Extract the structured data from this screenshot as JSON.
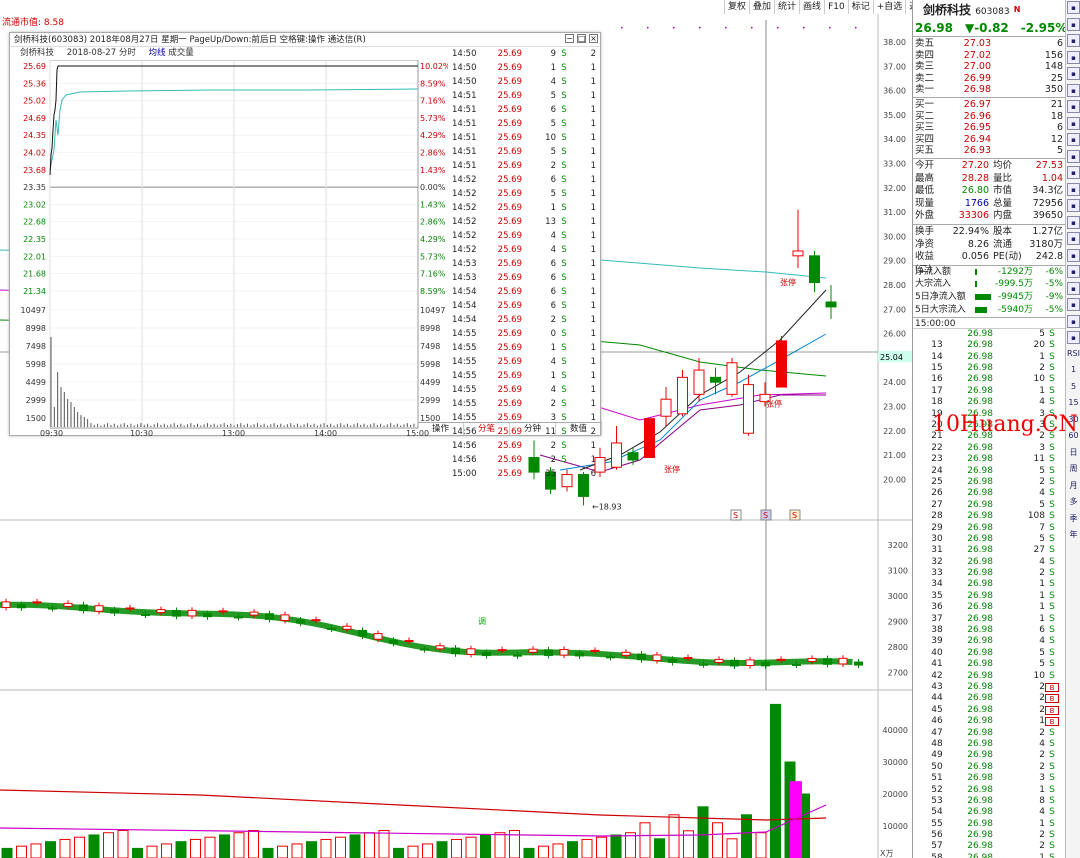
{
  "toolbar": [
    "复权",
    "叠加",
    "统计",
    "画线",
    "F10",
    "标记",
    "+自选",
    "返回"
  ],
  "market_cap": "流通市值: 8.58",
  "main_chart": {
    "price_axis": [
      "38.00",
      "37.00",
      "36.00",
      "35.00",
      "34.00",
      "33.00",
      "32.00",
      "31.00",
      "30.00",
      "29.00",
      "28.00",
      "27.00",
      "26.00",
      "25.00",
      "24.00",
      "23.00",
      "22.00",
      "21.00",
      "20.00"
    ],
    "current_price_label": "25.04",
    "low_label": "18.93",
    "limit_labels": [
      "张停",
      "张停",
      "张停"
    ],
    "index_axis": [
      "3200",
      "3100",
      "3000",
      "2900",
      "2800",
      "2700"
    ],
    "volume_axis": [
      "40000",
      "30000",
      "20000",
      "10000"
    ],
    "volume_unit": "X万",
    "index_badge": "调",
    "marker_icons": [
      "S",
      "S",
      "S"
    ],
    "candles": [
      {
        "o": 20.9,
        "c": 20.3,
        "h": 21.6,
        "l": 20.0
      },
      {
        "o": 20.3,
        "c": 19.6,
        "h": 20.5,
        "l": 19.4
      },
      {
        "o": 19.7,
        "c": 20.2,
        "h": 20.4,
        "l": 19.5
      },
      {
        "o": 20.2,
        "c": 19.3,
        "h": 20.3,
        "l": 18.93
      },
      {
        "o": 20.3,
        "c": 20.9,
        "h": 21.3,
        "l": 20.1
      },
      {
        "o": 20.5,
        "c": 21.5,
        "h": 22.2,
        "l": 20.4
      },
      {
        "o": 21.1,
        "c": 20.8,
        "h": 21.3,
        "l": 20.6
      },
      {
        "o": 20.9,
        "c": 22.5,
        "h": 22.5,
        "l": 20.9
      },
      {
        "o": 22.6,
        "c": 23.3,
        "h": 23.8,
        "l": 22.2
      },
      {
        "o": 22.7,
        "c": 24.2,
        "h": 24.5,
        "l": 22.6
      },
      {
        "o": 23.5,
        "c": 24.5,
        "h": 25.0,
        "l": 23.2
      },
      {
        "o": 24.2,
        "c": 24.0,
        "h": 24.6,
        "l": 23.5
      },
      {
        "o": 23.5,
        "c": 24.8,
        "h": 25.0,
        "l": 23.4
      },
      {
        "o": 21.9,
        "c": 23.9,
        "h": 24.3,
        "l": 21.8
      },
      {
        "o": 23.2,
        "c": 23.5,
        "h": 24.0,
        "l": 23.0
      },
      {
        "o": 23.8,
        "c": 25.7,
        "h": 25.9,
        "l": 23.8
      },
      {
        "o": 29.2,
        "c": 29.4,
        "h": 31.1,
        "l": 28.7
      },
      {
        "o": 29.2,
        "c": 28.1,
        "h": 29.4,
        "l": 27.7
      },
      {
        "o": 27.3,
        "c": 27.1,
        "h": 28.0,
        "l": 26.6
      }
    ]
  },
  "popup": {
    "title": "剑桥科技(603083)  2018年08月27日 星期一  PageUp/Down:前后日 空格键:操作 通达信(R)",
    "header": {
      "name": "剑桥科技",
      "date": "2018-08-27 分时",
      "avg": "均线",
      "vol": "成交量"
    },
    "left_axis": [
      "25.69",
      "25.36",
      "25.02",
      "24.69",
      "24.35",
      "24.02",
      "23.68",
      "23.35",
      "23.02",
      "22.68",
      "22.35",
      "22.01",
      "21.68",
      "21.34",
      "10497",
      "8998",
      "7498",
      "5998",
      "4499",
      "2999",
      "1500"
    ],
    "right_axis": [
      "10.02%",
      "8.59%",
      "7.16%",
      "5.73%",
      "4.29%",
      "2.86%",
      "1.43%",
      "0.00%",
      "1.43%",
      "2.86%",
      "4.29%",
      "5.73%",
      "7.16%",
      "8.59%",
      "10497",
      "8998",
      "7498",
      "5998",
      "4499",
      "2999",
      "1500"
    ],
    "time_axis": [
      "09:30",
      "10:30",
      "13:00",
      "14:00",
      "15:00"
    ],
    "trades": [
      [
        "14:50",
        "25.69",
        "9",
        "S",
        "2"
      ],
      [
        "14:50",
        "25.69",
        "1",
        "S",
        "1"
      ],
      [
        "14:50",
        "25.69",
        "4",
        "S",
        "1"
      ],
      [
        "14:51",
        "25.69",
        "5",
        "S",
        "1"
      ],
      [
        "14:51",
        "25.69",
        "6",
        "S",
        "1"
      ],
      [
        "14:51",
        "25.69",
        "5",
        "S",
        "1"
      ],
      [
        "14:51",
        "25.69",
        "10",
        "S",
        "1"
      ],
      [
        "14:51",
        "25.69",
        "5",
        "S",
        "1"
      ],
      [
        "14:51",
        "25.69",
        "2",
        "S",
        "1"
      ],
      [
        "14:52",
        "25.69",
        "6",
        "S",
        "1"
      ],
      [
        "14:52",
        "25.69",
        "5",
        "S",
        "1"
      ],
      [
        "14:52",
        "25.69",
        "1",
        "S",
        "1"
      ],
      [
        "14:52",
        "25.69",
        "13",
        "S",
        "1"
      ],
      [
        "14:52",
        "25.69",
        "4",
        "S",
        "1"
      ],
      [
        "14:52",
        "25.69",
        "4",
        "S",
        "1"
      ],
      [
        "14:53",
        "25.69",
        "6",
        "S",
        "1"
      ],
      [
        "14:53",
        "25.69",
        "6",
        "S",
        "1"
      ],
      [
        "14:54",
        "25.69",
        "6",
        "S",
        "1"
      ],
      [
        "14:54",
        "25.69",
        "6",
        "S",
        "1"
      ],
      [
        "14:54",
        "25.69",
        "2",
        "S",
        "1"
      ],
      [
        "14:55",
        "25.69",
        "0",
        "S",
        "1"
      ],
      [
        "14:55",
        "25.69",
        "1",
        "S",
        "1"
      ],
      [
        "14:55",
        "25.69",
        "4",
        "S",
        "1"
      ],
      [
        "14:55",
        "25.69",
        "1",
        "S",
        "1"
      ],
      [
        "14:55",
        "25.69",
        "4",
        "S",
        "1"
      ],
      [
        "14:55",
        "25.69",
        "2",
        "S",
        "1"
      ],
      [
        "14:55",
        "25.69",
        "3",
        "S",
        "1"
      ],
      [
        "14:56",
        "25.69",
        "11",
        "S",
        "2"
      ],
      [
        "14:56",
        "25.69",
        "2",
        "S",
        "1"
      ],
      [
        "14:56",
        "25.69",
        "2",
        "S",
        "1"
      ],
      [
        "15:00",
        "25.69",
        "35",
        "",
        "6"
      ]
    ],
    "tabs": [
      "操作",
      "分笔",
      "分钟",
      "数值"
    ]
  },
  "panel": {
    "name": "剑桥科技",
    "code": "603083",
    "flag": "N",
    "price": "26.98",
    "change": "▼-0.82",
    "pct": "-2.95%",
    "asks": [
      [
        "卖五",
        "27.03",
        "6"
      ],
      [
        "卖四",
        "27.02",
        "156"
      ],
      [
        "卖三",
        "27.00",
        "148"
      ],
      [
        "卖二",
        "26.99",
        "25"
      ],
      [
        "卖一",
        "26.98",
        "350"
      ]
    ],
    "bids": [
      [
        "买一",
        "26.97",
        "21"
      ],
      [
        "买二",
        "26.96",
        "18"
      ],
      [
        "买三",
        "26.95",
        "6"
      ],
      [
        "买四",
        "26.94",
        "12"
      ],
      [
        "买五",
        "26.93",
        "5"
      ]
    ],
    "stats": [
      [
        "今开",
        "27.20",
        "均价",
        "27.53"
      ],
      [
        "最高",
        "28.28",
        "量比",
        "1.04"
      ],
      [
        "最低",
        "26.80",
        "市值",
        "34.3亿"
      ],
      [
        "现量",
        "1766",
        "总量",
        "72956"
      ],
      [
        "外盘",
        "33306",
        "内盘",
        "39650"
      ]
    ],
    "stats2": [
      [
        "换手",
        "22.94%",
        "股本",
        "1.27亿"
      ],
      [
        "净资",
        "8.26",
        "流通",
        "3180万"
      ],
      [
        "收益(二)",
        "0.056",
        "PE(动)",
        "242.8"
      ]
    ],
    "flows": [
      [
        "净流入额",
        "-1292万",
        "-6%",
        2
      ],
      [
        "大宗流入",
        "-999.5万",
        "-5%",
        2
      ],
      [
        "5日净流入额",
        "-9945万",
        "-9%",
        16
      ],
      [
        "5日大宗流入",
        "-5940万",
        "-5%",
        12
      ]
    ],
    "tick_head": "15:00:00",
    "ticks": [
      [
        "",
        "26.98",
        "5",
        "S"
      ],
      [
        "13",
        "26.98",
        "20",
        "S"
      ],
      [
        "14",
        "26.98",
        "1",
        "S"
      ],
      [
        "15",
        "26.98",
        "2",
        "S"
      ],
      [
        "16",
        "26.98",
        "10",
        "S"
      ],
      [
        "17",
        "26.98",
        "1",
        "S"
      ],
      [
        "18",
        "26.98",
        "4",
        "S"
      ],
      [
        "19",
        "26.98",
        "3",
        "S"
      ],
      [
        "20",
        "26.98",
        "3",
        "S"
      ],
      [
        "21",
        "26.98",
        "2",
        "S"
      ],
      [
        "22",
        "26.98",
        "3",
        "S"
      ],
      [
        "23",
        "26.98",
        "11",
        "S"
      ],
      [
        "24",
        "26.98",
        "5",
        "S"
      ],
      [
        "25",
        "26.98",
        "2",
        "S"
      ],
      [
        "26",
        "26.98",
        "4",
        "S"
      ],
      [
        "27",
        "26.98",
        "5",
        "S"
      ],
      [
        "28",
        "26.98",
        "108",
        "S"
      ],
      [
        "29",
        "26.98",
        "7",
        "S"
      ],
      [
        "30",
        "26.98",
        "5",
        "S"
      ],
      [
        "31",
        "26.98",
        "27",
        "S"
      ],
      [
        "32",
        "26.98",
        "4",
        "S"
      ],
      [
        "33",
        "26.98",
        "2",
        "S"
      ],
      [
        "34",
        "26.98",
        "1",
        "S"
      ],
      [
        "35",
        "26.98",
        "1",
        "S"
      ],
      [
        "36",
        "26.98",
        "1",
        "S"
      ],
      [
        "37",
        "26.98",
        "1",
        "S"
      ],
      [
        "38",
        "26.98",
        "6",
        "S"
      ],
      [
        "39",
        "26.98",
        "4",
        "S"
      ],
      [
        "40",
        "26.98",
        "5",
        "S"
      ],
      [
        "41",
        "26.98",
        "5",
        "S"
      ],
      [
        "42",
        "26.98",
        "10",
        "S"
      ],
      [
        "43",
        "26.98",
        "2",
        "B"
      ],
      [
        "44",
        "26.98",
        "2",
        "B"
      ],
      [
        "45",
        "26.98",
        "2",
        "B"
      ],
      [
        "46",
        "26.98",
        "1",
        "B"
      ],
      [
        "47",
        "26.98",
        "2",
        "S"
      ],
      [
        "48",
        "26.98",
        "4",
        "S"
      ],
      [
        "49",
        "26.98",
        "2",
        "S"
      ],
      [
        "50",
        "26.98",
        "2",
        "S"
      ],
      [
        "51",
        "26.98",
        "3",
        "S"
      ],
      [
        "52",
        "26.98",
        "1",
        "S"
      ],
      [
        "53",
        "26.98",
        "8",
        "S"
      ],
      [
        "54",
        "26.98",
        "4",
        "S"
      ],
      [
        "55",
        "26.98",
        "1",
        "S"
      ],
      [
        "56",
        "26.98",
        "2",
        "S"
      ],
      [
        "57",
        "26.98",
        "2",
        "S"
      ],
      [
        "58",
        "26.98",
        "1",
        "S"
      ]
    ]
  },
  "side_icons": [
    "back-icon",
    "up-icon",
    "down-icon",
    "grid-icon",
    "chart-icon",
    "trend-icon",
    "bars-icon",
    "compare-icon",
    "info-icon",
    "doc-icon",
    "cash-icon",
    "f10-icon",
    "fund-icon",
    "money-icon",
    "plus-icon",
    "rsi-icon",
    "dollar-icon",
    "move-icon",
    "pen-icon",
    "f5-icon",
    "money2-icon"
  ],
  "side_labels": [
    "RSI",
    "1",
    "5",
    "15",
    "30",
    "60",
    "日",
    "周",
    "月",
    "多",
    "季",
    "年"
  ],
  "watermark": "10Huang.CN"
}
